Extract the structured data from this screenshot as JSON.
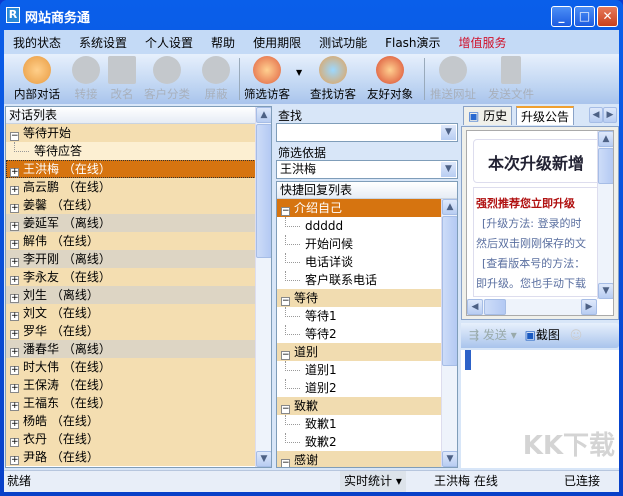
{
  "title": "网站商务通",
  "menu": [
    "我的状态",
    "系统设置",
    "个人设置",
    "帮助",
    "使用期限",
    "测试功能",
    "Flash演示",
    "增值服务"
  ],
  "toolbar": {
    "internal_chat": "内部对话",
    "transfer": "转接",
    "rename": "改名",
    "customer_category": "客户分类",
    "block": "屏蔽",
    "filter_visitors": "筛选访客",
    "find_visitors": "查找访客",
    "friendly_objects": "友好对象",
    "push_url": "推送网址",
    "send_file": "发送文件"
  },
  "left": {
    "header": "对话列表",
    "group": "等待开始",
    "waiting": "等待应答",
    "rows": [
      {
        "t": "王洪梅 （在线）",
        "s": "sel"
      },
      {
        "t": "高云鹏 （在线）",
        "s": "on"
      },
      {
        "t": "姜馨 （在线）",
        "s": "on"
      },
      {
        "t": "姜延军 （离线）",
        "s": "off"
      },
      {
        "t": "解伟 （在线）",
        "s": "on"
      },
      {
        "t": "李开刚 （离线）",
        "s": "off"
      },
      {
        "t": "李永友 （在线）",
        "s": "on"
      },
      {
        "t": "刘生 （离线）",
        "s": "off"
      },
      {
        "t": "刘文 （在线）",
        "s": "on"
      },
      {
        "t": "罗华 （在线）",
        "s": "on"
      },
      {
        "t": "潘春华 （离线）",
        "s": "off"
      },
      {
        "t": "时大伟 （在线）",
        "s": "on"
      },
      {
        "t": "王保涛 （在线）",
        "s": "on"
      },
      {
        "t": "王福东 （在线）",
        "s": "on"
      },
      {
        "t": "杨皓 （在线）",
        "s": "on"
      },
      {
        "t": "衣丹 （在线）",
        "s": "on"
      },
      {
        "t": "尹路 （在线）",
        "s": "on"
      }
    ]
  },
  "middle": {
    "find_label": "查找",
    "find_value": "",
    "filter_label": "筛选依据",
    "filter_value": "王洪梅",
    "list_header": "快捷回复列表",
    "groups": [
      {
        "name": "介绍自己",
        "items": [
          "ddddd",
          "开始问候",
          "电话详谈",
          "客户联系电话"
        ]
      },
      {
        "name": "等待",
        "items": [
          "等待1",
          "等待2"
        ]
      },
      {
        "name": "道别",
        "items": [
          "道别1",
          "道别2"
        ]
      },
      {
        "name": "致歉",
        "items": [
          "致歉1",
          "致歉2"
        ]
      },
      {
        "name": "感谢",
        "items": []
      }
    ]
  },
  "right": {
    "tabs": [
      "历史",
      "升级公告"
    ],
    "banner": "本次升级新增",
    "notice_title": "强烈推荐您立即升级",
    "lines": [
      "[升级方法: 登录的时",
      "然后双击刚刚保存的文",
      "[查看版本号的方法：",
      "即升级。您也手动下载"
    ],
    "send": "发送",
    "screenshot": "截图"
  },
  "status": {
    "ready": "就绪",
    "stats": "实时统计",
    "user": "王洪梅 在线",
    "connected": "已连接"
  },
  "watermark": "KK下载"
}
